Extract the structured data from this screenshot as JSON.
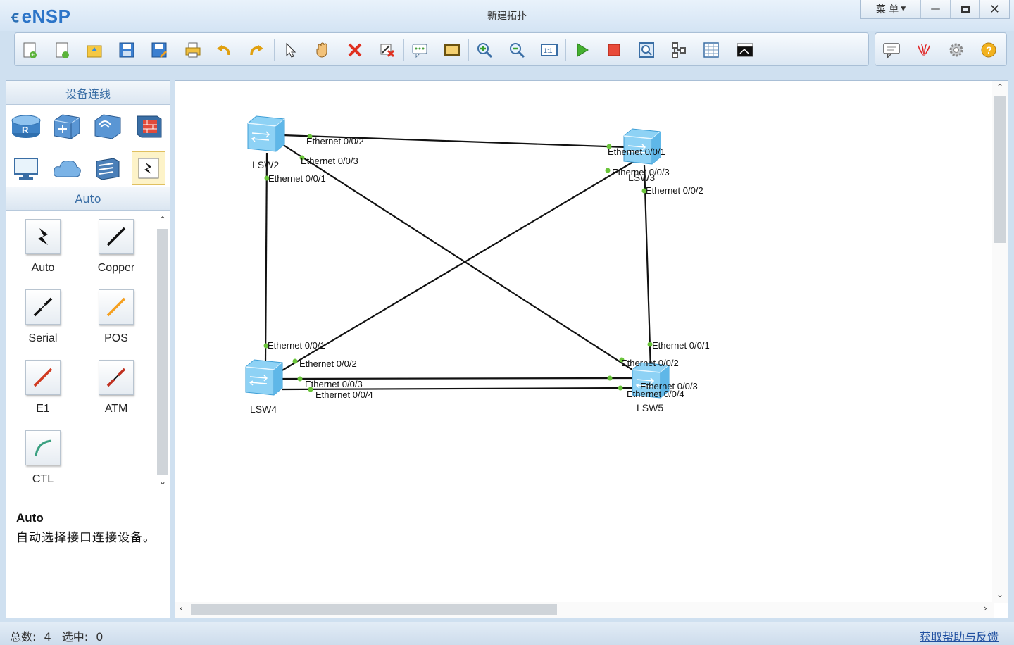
{
  "app": {
    "name": "eNSP",
    "window_title": "新建拓扑",
    "menu_label": "菜 单"
  },
  "toolbar": {
    "icons": [
      "new-topology-icon",
      "new-example-icon",
      "open-icon",
      "save-icon",
      "save-as-icon",
      "print-icon",
      "undo-icon",
      "redo-icon",
      "select-icon",
      "pan-icon",
      "delete-icon",
      "delete-link-icon",
      "text-annotation-icon",
      "rectangle-icon",
      "zoom-in-icon",
      "zoom-out-icon",
      "fit-icon",
      "start-icon",
      "stop-icon",
      "capture-icon",
      "topology-icon",
      "grid-icon",
      "terminal-icon"
    ],
    "right_icons": [
      "feedback-icon",
      "huawei-icon",
      "settings-icon",
      "help-icon"
    ]
  },
  "left_panel": {
    "header": "设备连线",
    "category": "Auto",
    "cables": [
      {
        "label": "Auto"
      },
      {
        "label": "Copper"
      },
      {
        "label": "Serial"
      },
      {
        "label": "POS"
      },
      {
        "label": "E1"
      },
      {
        "label": "ATM"
      },
      {
        "label": "CTL"
      }
    ],
    "description_title": "Auto",
    "description_text": "自动选择接口连接设备。"
  },
  "topology": {
    "devices": [
      {
        "name": "LSW2"
      },
      {
        "name": "LSW3"
      },
      {
        "name": "LSW4"
      },
      {
        "name": "LSW5"
      }
    ],
    "port_labels": [
      "Ethernet 0/0/2",
      "Ethernet 0/0/3",
      "Ethernet 0/0/1",
      "Ethernet 0/0/1",
      "Ethernet 0/0/3",
      "Ethernet 0/0/2",
      "Ethernet 0/0/1",
      "Ethernet 0/0/2",
      "Ethernet 0/0/3",
      "Ethernet 0/0/4",
      "Ethernet 0/0/1",
      "Ethernet 0/0/2",
      "Ethernet 0/0/3",
      "Ethernet 0/0/4"
    ]
  },
  "status": {
    "total_label": "总数:",
    "total_value": "4",
    "selected_label": "选中:",
    "selected_value": "0",
    "help_link": "获取帮助与反馈"
  }
}
